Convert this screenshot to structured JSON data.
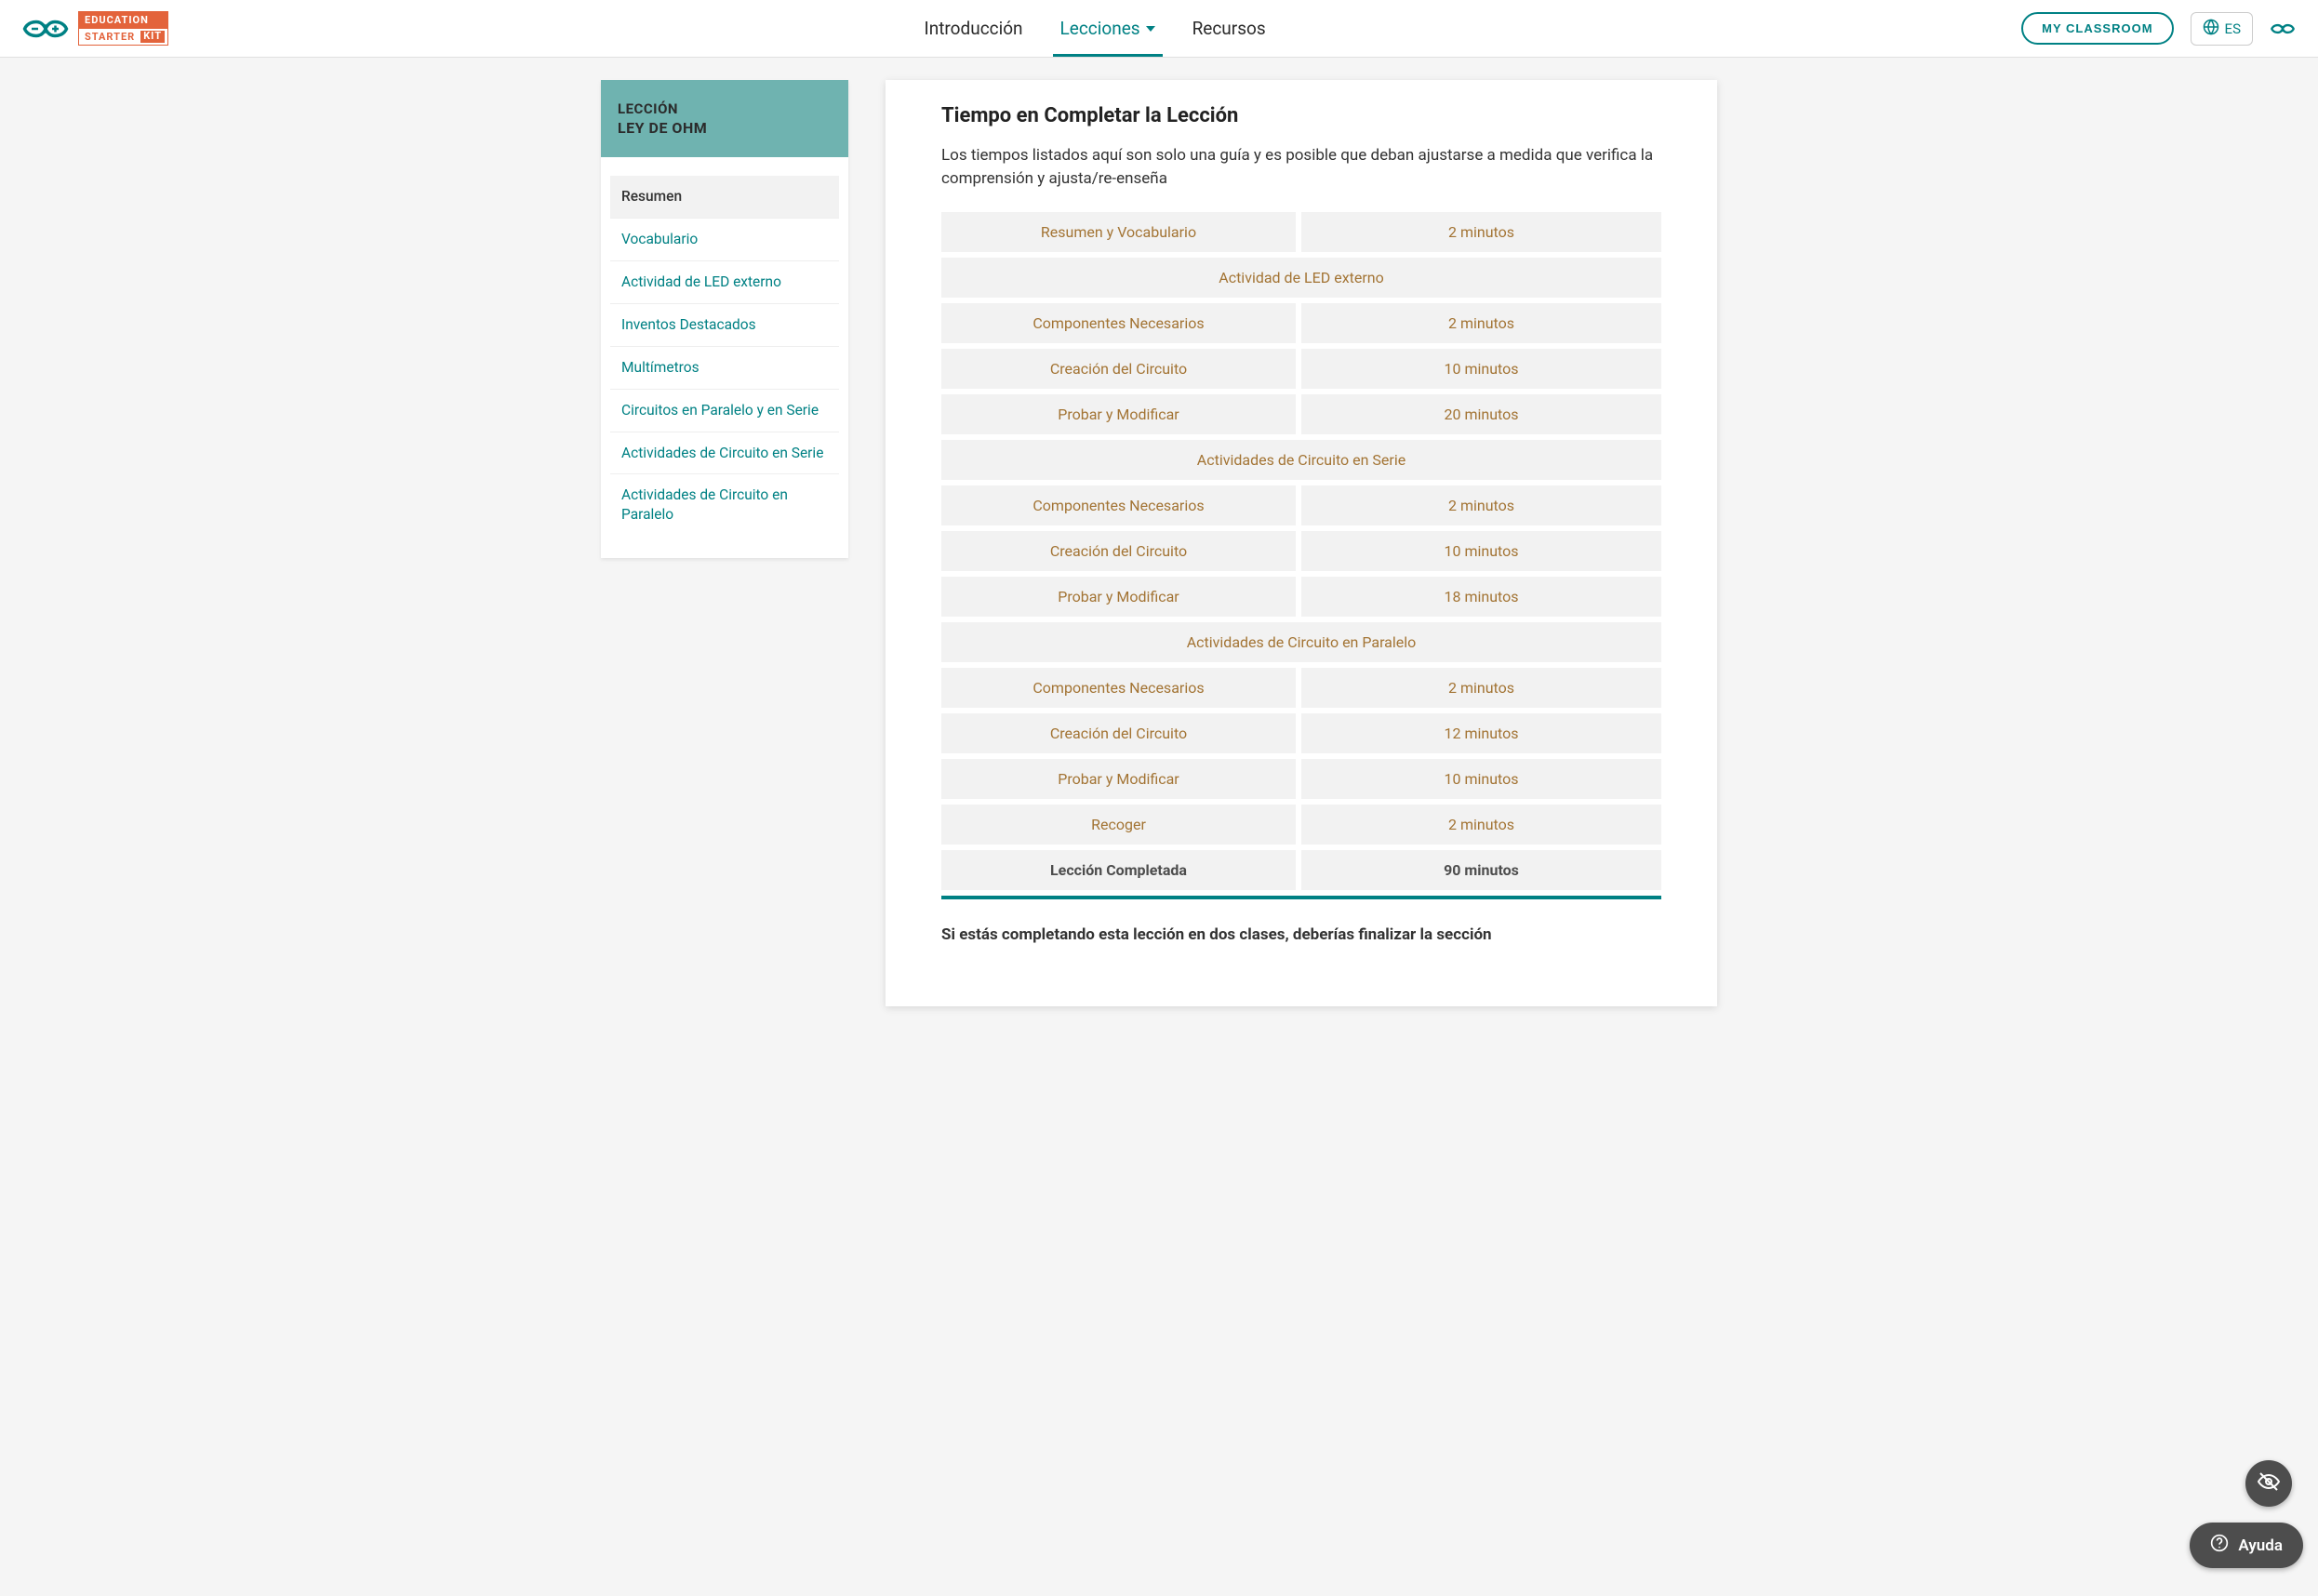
{
  "header": {
    "edu_top": "EDUCATION",
    "edu_bottom_left": "STARTER",
    "edu_bottom_right": "KIT",
    "nav": {
      "intro": "Introducción",
      "lessons": "Lecciones",
      "resources": "Recursos"
    },
    "classroom_btn": "MY CLASSROOM",
    "lang": "ES"
  },
  "sidebar": {
    "label": "LECCIÓN",
    "title": "LEY DE OHM",
    "items": [
      "Resumen",
      "Vocabulario",
      "Actividad de LED externo",
      "Inventos Destacados",
      "Multímetros",
      "Circuitos en Paralelo y en Serie",
      "Actividades de Circuito en Serie",
      "Actividades de Circuito en Paralelo"
    ]
  },
  "content": {
    "heading": "Tiempo en Completar la Lección",
    "intro": "Los tiempos listados aquí son solo una guía y es posible que deban ajustarse a medida que verifica la comprensión y ajusta/re-enseña",
    "rows": [
      {
        "type": "pair",
        "label": "Resumen y Vocabulario",
        "time": "2 minutos"
      },
      {
        "type": "section",
        "label": "Actividad de LED externo"
      },
      {
        "type": "pair",
        "label": "Componentes Necesarios",
        "time": "2 minutos"
      },
      {
        "type": "pair",
        "label": "Creación del Circuito",
        "time": "10 minutos"
      },
      {
        "type": "pair",
        "label": "Probar y Modificar",
        "time": "20 minutos"
      },
      {
        "type": "section",
        "label": "Actividades de Circuito en Serie"
      },
      {
        "type": "pair",
        "label": "Componentes Necesarios",
        "time": "2 minutos"
      },
      {
        "type": "pair",
        "label": "Creación del Circuito",
        "time": "10 minutos"
      },
      {
        "type": "pair",
        "label": "Probar y Modificar",
        "time": "18 minutos"
      },
      {
        "type": "section",
        "label": "Actividades de Circuito en Paralelo"
      },
      {
        "type": "pair",
        "label": "Componentes Necesarios",
        "time": "2 minutos"
      },
      {
        "type": "pair",
        "label": "Creación del Circuito",
        "time": "12 minutos"
      },
      {
        "type": "pair",
        "label": "Probar y Modificar",
        "time": "10 minutos"
      },
      {
        "type": "pair",
        "label": "Recoger",
        "time": "2 minutos"
      },
      {
        "type": "total",
        "label": "Lección Completada",
        "time": "90 minutos"
      }
    ],
    "bottom_note": "Si estás completando esta lección en dos clases, deberías finalizar la sección"
  },
  "help": {
    "label": "Ayuda"
  }
}
